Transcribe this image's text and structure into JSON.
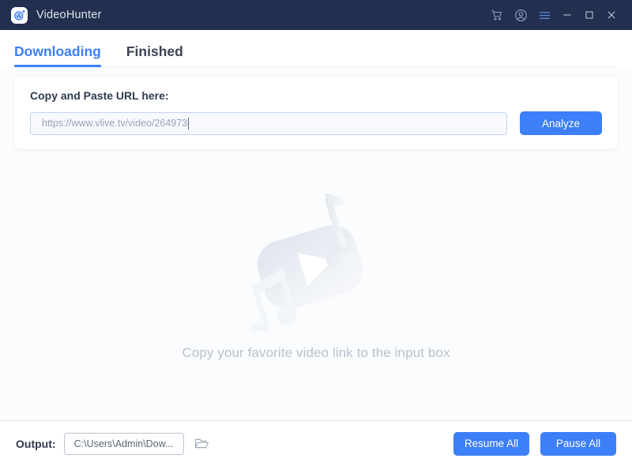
{
  "window": {
    "app_title": "VideoHunter",
    "logo_icon": "videohunter-logo-icon",
    "controls": {
      "cart_icon": "shopping-cart-icon",
      "account_icon": "user-account-icon",
      "menu_icon": "hamburger-menu-icon",
      "minimize_icon": "minimize-icon",
      "maximize_icon": "maximize-icon",
      "close_icon": "close-icon"
    },
    "colors": {
      "titlebar_bg": "#222f4e",
      "accent_blue": "#3d7ff8",
      "page_bg": "#fbfcfd",
      "title_text": "#dfe5ef",
      "icon_blue": "#8ba3c8"
    }
  },
  "tabs": [
    {
      "label": "Downloading",
      "active": true
    },
    {
      "label": "Finished",
      "active": false
    }
  ],
  "url_card": {
    "label": "Copy and Paste URL here:",
    "input_value": "https://www.vlive.tv/video/264973",
    "input_placeholder": "https://www.vlive.tv/video/264973",
    "analyze_label": "Analyze"
  },
  "empty_state": {
    "art_icon": "video-music-placeholder-icon",
    "message": "Copy your favorite video link to the input box"
  },
  "footer": {
    "output_label": "Output:",
    "output_path": "C:\\Users\\Admin\\Dow...",
    "folder_icon": "open-folder-icon",
    "resume_all_label": "Resume All",
    "pause_all_label": "Pause All"
  }
}
